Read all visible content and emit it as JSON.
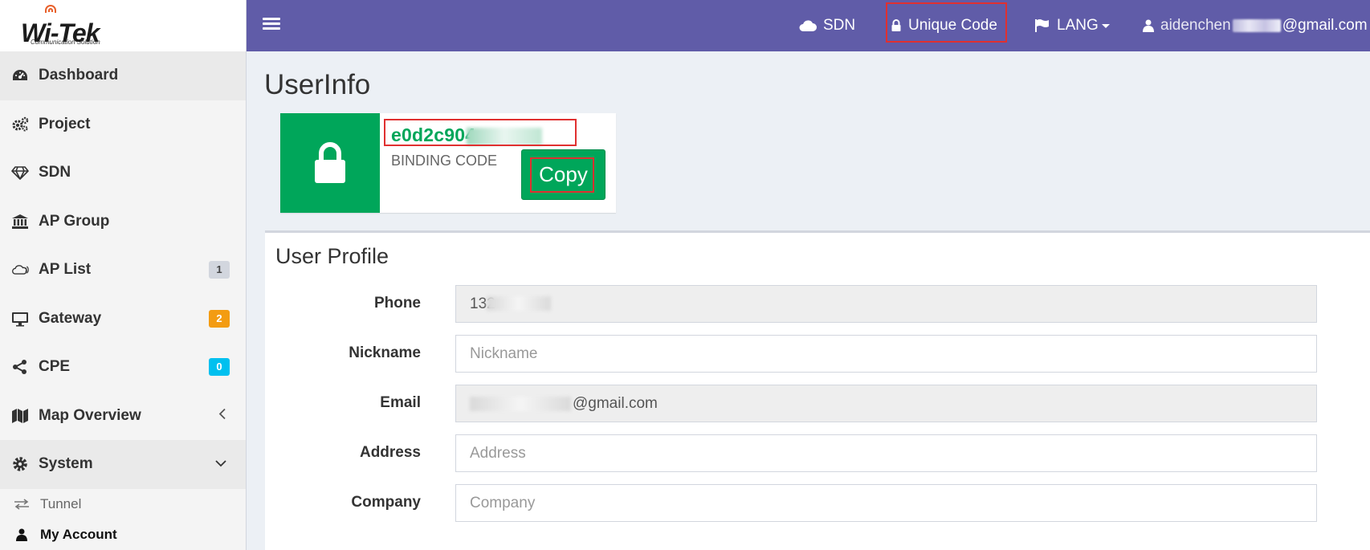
{
  "brand": {
    "logo_main": "Wi-Tek",
    "logo_sub": "Communication Solution"
  },
  "sidebar": {
    "items": [
      {
        "label": "Dashboard",
        "icon": "dashboard-icon"
      },
      {
        "label": "Project",
        "icon": "gears-icon"
      },
      {
        "label": "SDN",
        "icon": "diamond-icon"
      },
      {
        "label": "AP Group",
        "icon": "bank-icon"
      },
      {
        "label": "AP List",
        "icon": "cloud-wifi-icon",
        "badge": "1"
      },
      {
        "label": "Gateway",
        "icon": "monitor-icon",
        "badge": "2"
      },
      {
        "label": "CPE",
        "icon": "share-icon",
        "badge": "0"
      },
      {
        "label": "Map Overview",
        "icon": "map-icon"
      },
      {
        "label": "System",
        "icon": "gear-icon"
      }
    ],
    "submenu": [
      {
        "label": "Tunnel",
        "icon": "exchange-icon"
      },
      {
        "label": "My Account",
        "icon": "user-icon"
      }
    ]
  },
  "navbar": {
    "sdn_label": "SDN",
    "unique_code_label": "Unique Code",
    "lang_label": "LANG",
    "account_prefix": "aidenchen",
    "account_suffix": "@gmail.com"
  },
  "page": {
    "title": "UserInfo"
  },
  "binding": {
    "code": "e0d2c904",
    "label": "BINDING CODE",
    "copy_label": "Copy"
  },
  "profile": {
    "title": "User Profile",
    "fields": [
      {
        "label": "Phone",
        "value": "132",
        "placeholder": ""
      },
      {
        "label": "Nickname",
        "value": "",
        "placeholder": "Nickname"
      },
      {
        "label": "Email",
        "value": "@gmail.com",
        "placeholder": ""
      },
      {
        "label": "Address",
        "value": "",
        "placeholder": "Address"
      },
      {
        "label": "Company",
        "value": "",
        "placeholder": "Company"
      }
    ]
  },
  "colors": {
    "navbar": "#605ca8",
    "success": "#00a65a",
    "highlight": "#e03030",
    "badge_orange": "#f39c12",
    "badge_cyan": "#00c0ef"
  }
}
